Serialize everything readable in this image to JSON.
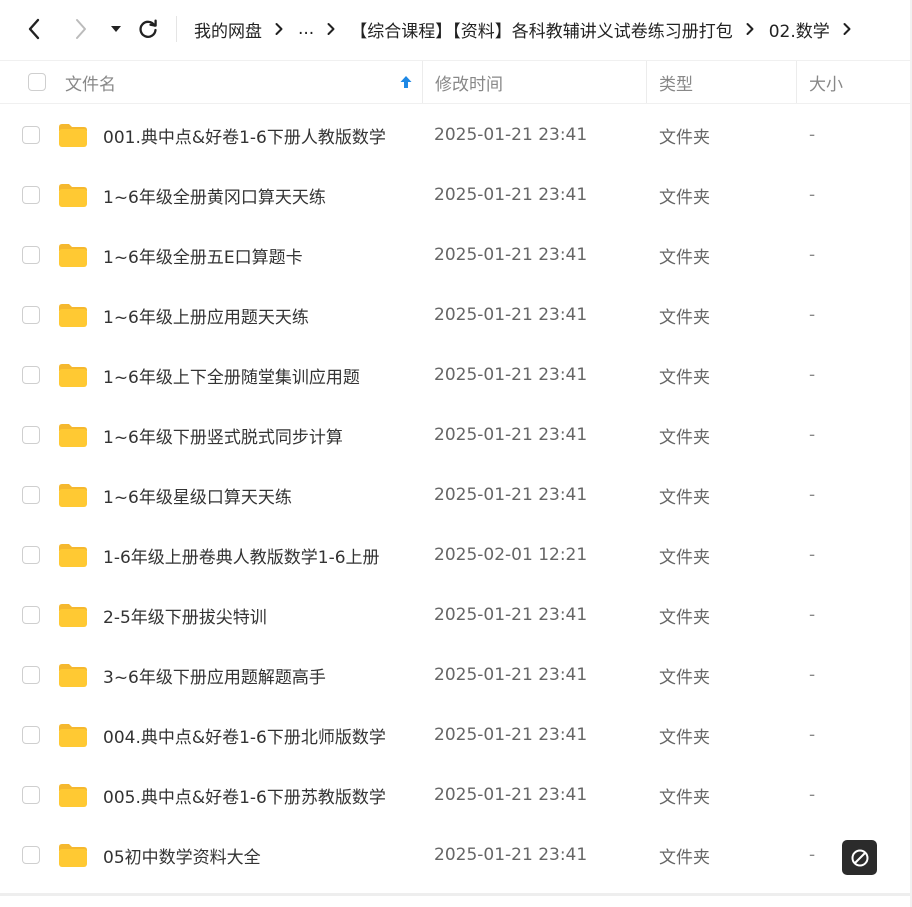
{
  "toolbar": {
    "breadcrumb": [
      {
        "label": "我的网盘"
      },
      {
        "label": "..."
      },
      {
        "label": "【综合课程】【资料】各科教辅讲义试卷练习册打包"
      },
      {
        "label": "02.数学"
      }
    ]
  },
  "table": {
    "headers": {
      "name": "文件名",
      "mtime": "修改时间",
      "type": "类型",
      "size": "大小"
    },
    "sort": {
      "column": "name",
      "direction": "ascending"
    },
    "rows": [
      {
        "name": "001.典中点&好卷1-6下册人教版数学",
        "mtime": "2025-01-21 23:41",
        "type": "文件夹",
        "size": "-"
      },
      {
        "name": "1~6年级全册黄冈口算天天练",
        "mtime": "2025-01-21 23:41",
        "type": "文件夹",
        "size": "-"
      },
      {
        "name": "1~6年级全册五E口算题卡",
        "mtime": "2025-01-21 23:41",
        "type": "文件夹",
        "size": "-"
      },
      {
        "name": "1~6年级上册应用题天天练",
        "mtime": "2025-01-21 23:41",
        "type": "文件夹",
        "size": "-"
      },
      {
        "name": "1~6年级上下全册随堂集训应用题",
        "mtime": "2025-01-21 23:41",
        "type": "文件夹",
        "size": "-"
      },
      {
        "name": "1~6年级下册竖式脱式同步计算",
        "mtime": "2025-01-21 23:41",
        "type": "文件夹",
        "size": "-"
      },
      {
        "name": "1~6年级星级口算天天练",
        "mtime": "2025-01-21 23:41",
        "type": "文件夹",
        "size": "-"
      },
      {
        "name": "1-6年级上册卷典人教版数学1-6上册",
        "mtime": "2025-02-01 12:21",
        "type": "文件夹",
        "size": "-"
      },
      {
        "name": "2-5年级下册拔尖特训",
        "mtime": "2025-01-21 23:41",
        "type": "文件夹",
        "size": "-"
      },
      {
        "name": "3~6年级下册应用题解题高手",
        "mtime": "2025-01-21 23:41",
        "type": "文件夹",
        "size": "-"
      },
      {
        "name": "004.典中点&好卷1-6下册北师版数学",
        "mtime": "2025-01-21 23:41",
        "type": "文件夹",
        "size": "-"
      },
      {
        "name": "005.典中点&好卷1-6下册苏教版数学",
        "mtime": "2025-01-21 23:41",
        "type": "文件夹",
        "size": "-"
      },
      {
        "name": "05初中数学资料大全",
        "mtime": "2025-01-21 23:41",
        "type": "文件夹",
        "size": "-"
      }
    ]
  },
  "icons": {
    "back": "chevron-left-icon",
    "forward": "chevron-right-icon",
    "dropdown": "caret-down-icon",
    "refresh": "refresh-icon",
    "folder": "folder-icon",
    "sort": "sort-ascending-icon",
    "float": "block-icon"
  },
  "colors": {
    "folder": "#FFC933",
    "folder_tab": "#F5B82E",
    "sort_arrow": "#1E88E5",
    "float_button": "#2B2B2B",
    "forward_disabled": "#BBBBBB"
  }
}
